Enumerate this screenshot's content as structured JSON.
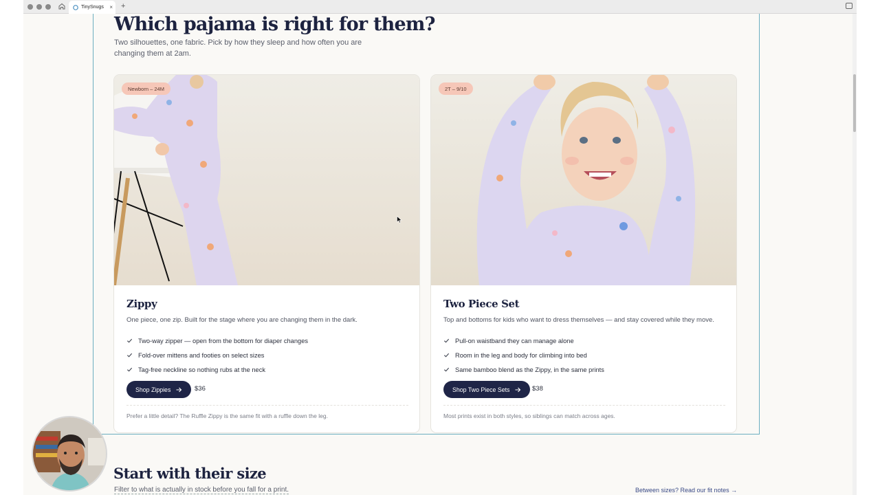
{
  "browser": {
    "tab_title": "TinySnugs",
    "tab_close": "×",
    "new_tab": "+"
  },
  "section": {
    "title": "Which pajama is right for them?",
    "subtitle": "Two silhouettes, one fabric. Pick by how they sleep and how often you are changing them at 2am."
  },
  "cards": [
    {
      "badge": "Newborn – 24M",
      "name": "Zippy",
      "description": "One piece, one zip. Built for the stage where you are changing them in the dark.",
      "features": [
        "Two-way zipper — open from the bottom for diaper changes",
        "Fold-over mittens and footies on select sizes",
        "Tag-free neckline so nothing rubs at the neck"
      ],
      "button": "Shop Zippies",
      "price": "$36",
      "note": "Prefer a little detail? The Ruffle Zippy is the same fit with a ruffle down the leg."
    },
    {
      "badge": "2T – 9/10",
      "name": "Two Piece Set",
      "description": "Top and bottoms for kids who want to dress themselves — and stay covered while they move.",
      "features": [
        "Pull-on waistband they can manage alone",
        "Room in the leg and body for climbing into bed",
        "Same bamboo blend as the Zippy, in the same prints"
      ],
      "button": "Shop Two Piece Sets",
      "price": "$38",
      "note": "Most prints exist in both styles, so siblings can match across ages."
    }
  ],
  "next_section": {
    "title": "Start with their size",
    "subtitle": "Filter to what is actually in stock before you fall for a print.",
    "fit_link": "Between sizes? Read our fit notes →"
  },
  "icons": {
    "check": "check-icon",
    "arrow": "arrow-right-icon"
  },
  "colors": {
    "navy": "#1f2547",
    "badge": "#f6c7b8",
    "section_border": "#6aaec0"
  }
}
